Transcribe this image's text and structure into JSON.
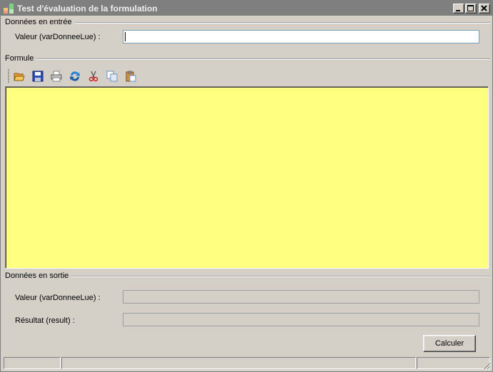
{
  "window": {
    "title": "Test d'évaluation de la formulation"
  },
  "input_group": {
    "label": "Données en entrée",
    "value_label": "Valeur (varDonneeLue) :",
    "value": ""
  },
  "formula_group": {
    "label": "Formule",
    "toolbar": [
      "open-icon",
      "save-icon",
      "print-icon",
      "refresh-icon",
      "cut-icon",
      "copy-icon",
      "paste-icon"
    ],
    "content": ""
  },
  "output_group": {
    "label": "Données en sortie",
    "value_label": "Valeur (varDonneeLue) :",
    "value": "",
    "result_label": "Résultat (result) :",
    "result": ""
  },
  "actions": {
    "calculate_label": "Calculer"
  },
  "colors": {
    "editor_background": "#ffff80",
    "titlebar": "#7f7f7f"
  }
}
